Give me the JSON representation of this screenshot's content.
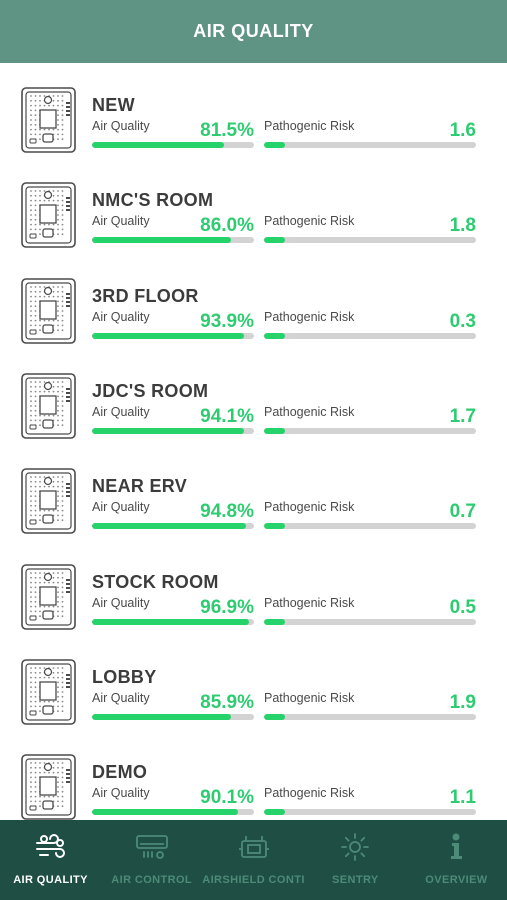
{
  "header": {
    "title": "AIR QUALITY"
  },
  "labels": {
    "air_quality": "Air Quality",
    "pathogenic_risk": "Pathogenic Risk"
  },
  "rooms": [
    {
      "name": "NEW",
      "air_quality": "81.5%",
      "air_quality_pct": 81.5,
      "pathogenic_risk": "1.6",
      "pathogenic_risk_fraction": 0.1
    },
    {
      "name": "NMC'S ROOM",
      "air_quality": "86.0%",
      "air_quality_pct": 86.0,
      "pathogenic_risk": "1.8",
      "pathogenic_risk_fraction": 0.1
    },
    {
      "name": "3RD FLOOR",
      "air_quality": "93.9%",
      "air_quality_pct": 93.9,
      "pathogenic_risk": "0.3",
      "pathogenic_risk_fraction": 0.1
    },
    {
      "name": "JDC'S ROOM",
      "air_quality": "94.1%",
      "air_quality_pct": 94.1,
      "pathogenic_risk": "1.7",
      "pathogenic_risk_fraction": 0.1
    },
    {
      "name": "NEAR ERV",
      "air_quality": "94.8%",
      "air_quality_pct": 94.8,
      "pathogenic_risk": "0.7",
      "pathogenic_risk_fraction": 0.1
    },
    {
      "name": "STOCK ROOM",
      "air_quality": "96.9%",
      "air_quality_pct": 96.9,
      "pathogenic_risk": "0.5",
      "pathogenic_risk_fraction": 0.1
    },
    {
      "name": "LOBBY",
      "air_quality": "85.9%",
      "air_quality_pct": 85.9,
      "pathogenic_risk": "1.9",
      "pathogenic_risk_fraction": 0.1
    },
    {
      "name": "DEMO",
      "air_quality": "90.1%",
      "air_quality_pct": 90.1,
      "pathogenic_risk": "1.1",
      "pathogenic_risk_fraction": 0.1
    }
  ],
  "tabs": [
    {
      "label": "AIR QUALITY",
      "icon": "wind-icon",
      "active": true
    },
    {
      "label": "AIR CONTROL",
      "icon": "air-conditioner-icon",
      "active": false
    },
    {
      "label": "AIRSHIELD CONTI",
      "icon": "airshield-device-icon",
      "active": false
    },
    {
      "label": "SENTRY",
      "icon": "sentry-sun-icon",
      "active": false
    },
    {
      "label": "OVERVIEW",
      "icon": "info-icon",
      "active": false
    }
  ],
  "colors": {
    "header_bg": "#5f9384",
    "tabbar_bg": "#1e4e44",
    "accent_green": "#26d36b",
    "value_green": "#2ecc71",
    "track_gray": "#d3d3d3",
    "tab_inactive": "#4d8a78"
  }
}
